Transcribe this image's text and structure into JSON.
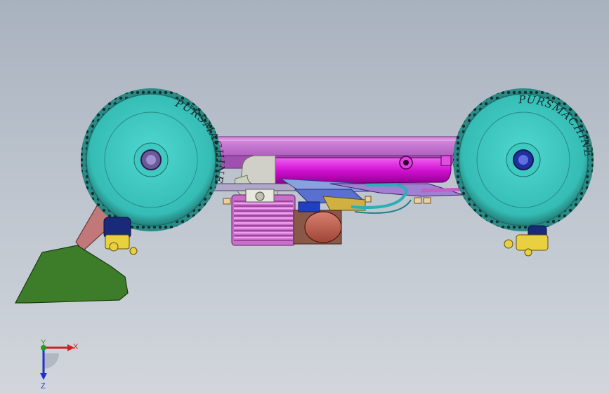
{
  "viewport": {
    "background_top": "#a8b2be",
    "background_bottom": "#d2d6dc"
  },
  "model": {
    "tire_brand_text": "PURSMACHINE",
    "tire_sidewall_small_text": "PURSMACHINE",
    "colors": {
      "tire": "#3fc9c1",
      "tire_tread": "#2a8a86",
      "chassis_top": "#c870d6",
      "chassis_plate": "#b464c8",
      "exhaust_pipe": "#e020e0",
      "engine_fins": "#cc55cc",
      "starter": "#c06050",
      "fuel_line": "#2ab0b8",
      "wing": "#3a7a2a",
      "wing_mount": "#c07070",
      "hub_yellow": "#e8d040",
      "shock_blue": "#1a2a8a"
    }
  },
  "triad": {
    "x_label": "X",
    "y_label": "Y",
    "z_label": "Z",
    "x_color": "#d02020",
    "y_color": "#20a020",
    "z_color": "#2030d0"
  }
}
